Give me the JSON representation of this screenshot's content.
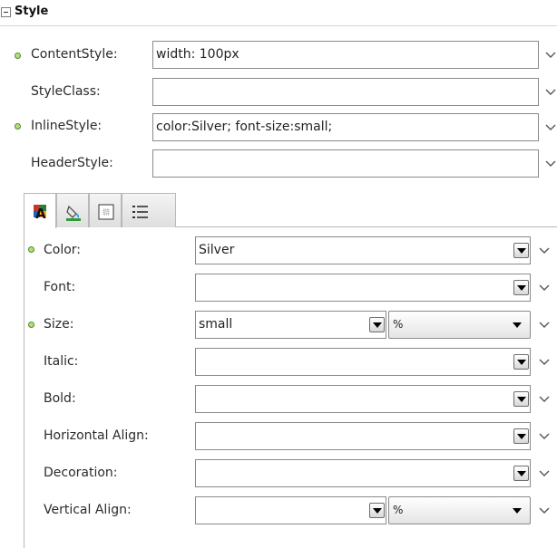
{
  "section": {
    "title": "Style"
  },
  "outer_rows": [
    {
      "label": "ContentStyle:",
      "value": "width: 100px",
      "has_value_indicator": true
    },
    {
      "label": "StyleClass:",
      "value": "",
      "has_value_indicator": false
    },
    {
      "label": "InlineStyle:",
      "value": "color:Silver; font-size:small;",
      "has_value_indicator": true
    },
    {
      "label": "HeaderStyle:",
      "value": "",
      "has_value_indicator": false
    }
  ],
  "tabs": [
    {
      "icon": "text-format-icon",
      "active": true
    },
    {
      "icon": "paint-bucket-icon",
      "active": false
    },
    {
      "icon": "box-model-icon",
      "active": false
    },
    {
      "icon": "list-icon",
      "active": false
    }
  ],
  "text_props": [
    {
      "label": "Color:",
      "value": "Silver",
      "has_value_indicator": true
    },
    {
      "label": "Font:",
      "value": "",
      "has_value_indicator": false
    },
    {
      "label": "Size:",
      "value": "small",
      "unit": "%",
      "has_value_indicator": true
    },
    {
      "label": "Italic:",
      "value": "",
      "has_value_indicator": false
    },
    {
      "label": "Bold:",
      "value": "",
      "has_value_indicator": false
    },
    {
      "label": "Horizontal Align:",
      "value": "",
      "has_value_indicator": false
    },
    {
      "label": "Decoration:",
      "value": "",
      "has_value_indicator": false
    },
    {
      "label": "Vertical Align:",
      "value": "",
      "unit": "%",
      "has_value_indicator": false
    }
  ],
  "colors": {
    "indicator": "#b6de7c",
    "indicator_border": "#4e8a2e",
    "field_border": "#8a8a8a"
  }
}
